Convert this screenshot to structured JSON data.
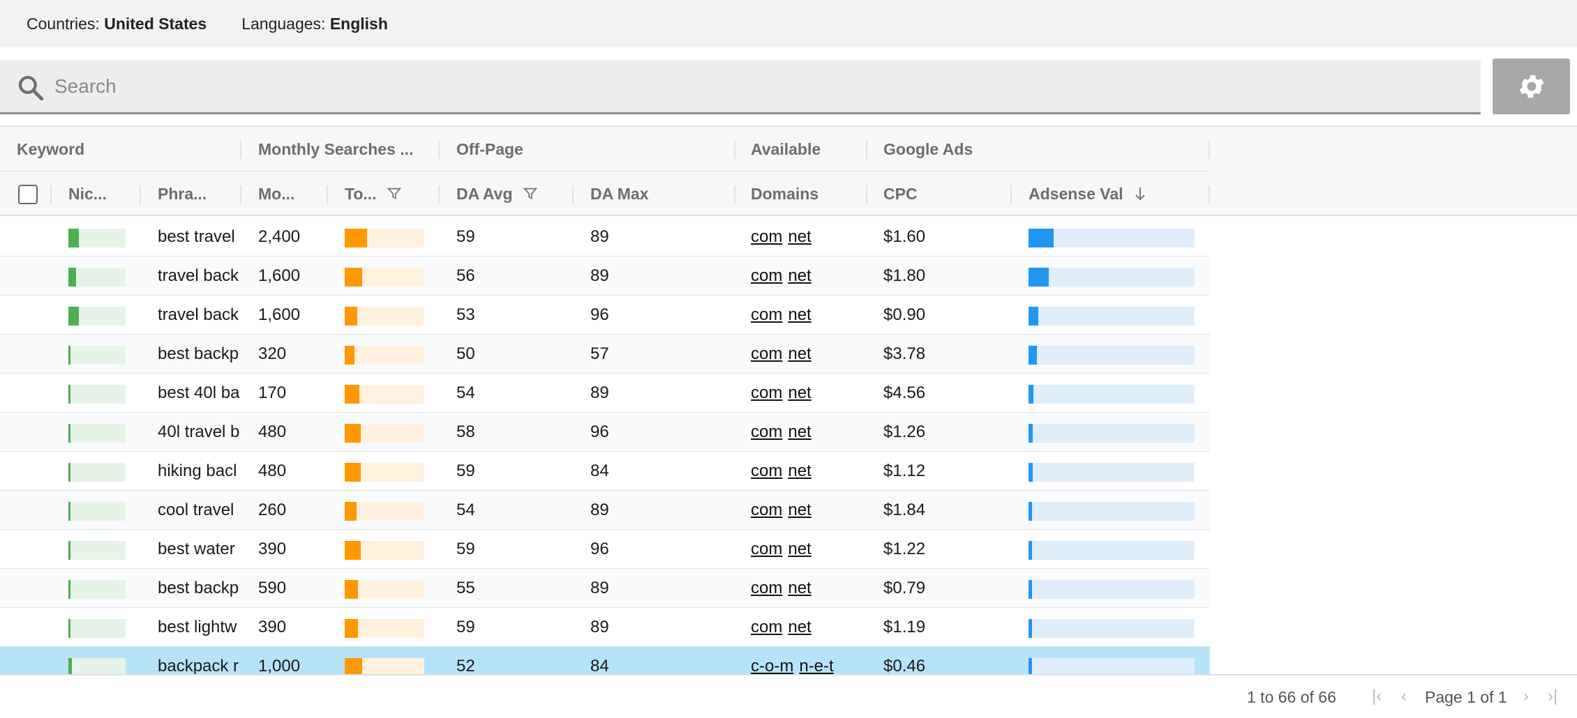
{
  "filters": {
    "countries_label": "Countries:",
    "countries_value": "United States",
    "languages_label": "Languages:",
    "languages_value": "English"
  },
  "search": {
    "placeholder": "Search"
  },
  "header_groups": [
    "Keyword",
    "Monthly Searches ...",
    "Off-Page",
    "Available",
    "Google Ads"
  ],
  "columns": [
    "Nic...",
    "Phra...",
    "Mo...",
    "To...",
    "DA Avg",
    "DA Max",
    "Domains",
    "CPC",
    "Adsense Val"
  ],
  "rows": [
    {
      "niche": 0.18,
      "phrase": "best travel",
      "monthly": "2,400",
      "to": 0.28,
      "da_avg": "59",
      "da_max": "89",
      "domains": [
        "com",
        "net"
      ],
      "cpc": "$1.60",
      "adsense": 0.15
    },
    {
      "niche": 0.14,
      "phrase": "travel back",
      "monthly": "1,600",
      "to": 0.22,
      "da_avg": "56",
      "da_max": "89",
      "domains": [
        "com",
        "net"
      ],
      "cpc": "$1.80",
      "adsense": 0.12
    },
    {
      "niche": 0.18,
      "phrase": "travel back",
      "monthly": "1,600",
      "to": 0.16,
      "da_avg": "53",
      "da_max": "96",
      "domains": [
        "com",
        "net"
      ],
      "cpc": "$0.90",
      "adsense": 0.06
    },
    {
      "niche": 0.04,
      "phrase": "best backp",
      "monthly": "320",
      "to": 0.12,
      "da_avg": "50",
      "da_max": "57",
      "domains": [
        "com",
        "net"
      ],
      "cpc": "$3.78",
      "adsense": 0.05
    },
    {
      "niche": 0.03,
      "phrase": "best 40l ba",
      "monthly": "170",
      "to": 0.18,
      "da_avg": "54",
      "da_max": "89",
      "domains": [
        "com",
        "net"
      ],
      "cpc": "$4.56",
      "adsense": 0.03
    },
    {
      "niche": 0.04,
      "phrase": "40l travel b",
      "monthly": "480",
      "to": 0.2,
      "da_avg": "58",
      "da_max": "96",
      "domains": [
        "com",
        "net"
      ],
      "cpc": "$1.26",
      "adsense": 0.025
    },
    {
      "niche": 0.04,
      "phrase": "hiking bacl",
      "monthly": "480",
      "to": 0.2,
      "da_avg": "59",
      "da_max": "84",
      "domains": [
        "com",
        "net"
      ],
      "cpc": "$1.12",
      "adsense": 0.025
    },
    {
      "niche": 0.02,
      "phrase": "cool travel",
      "monthly": "260",
      "to": 0.15,
      "da_avg": "54",
      "da_max": "89",
      "domains": [
        "com",
        "net"
      ],
      "cpc": "$1.84",
      "adsense": 0.02
    },
    {
      "niche": 0.02,
      "phrase": "best water",
      "monthly": "390",
      "to": 0.2,
      "da_avg": "59",
      "da_max": "96",
      "domains": [
        "com",
        "net"
      ],
      "cpc": "$1.22",
      "adsense": 0.02
    },
    {
      "niche": 0.03,
      "phrase": "best backp",
      "monthly": "590",
      "to": 0.17,
      "da_avg": "55",
      "da_max": "89",
      "domains": [
        "com",
        "net"
      ],
      "cpc": "$0.79",
      "adsense": 0.02
    },
    {
      "niche": 0.03,
      "phrase": "best lightw",
      "monthly": "390",
      "to": 0.17,
      "da_avg": "59",
      "da_max": "89",
      "domains": [
        "com",
        "net"
      ],
      "cpc": "$1.19",
      "adsense": 0.02
    },
    {
      "niche": 0.06,
      "phrase": "backpack r",
      "monthly": "1,000",
      "to": 0.22,
      "da_avg": "52",
      "da_max": "84",
      "domains": [
        "c-o-m",
        "n-e-t"
      ],
      "cpc": "$0.46",
      "adsense": 0.02,
      "selected": true
    }
  ],
  "footer": {
    "summary": "1 to 66 of 66",
    "page_info": "Page 1 of 1"
  },
  "colors": {
    "niche_fill": "#4caf50",
    "niche_track": "#e6f4e8",
    "to_fill": "#ff9800",
    "to_track": "#fff1de",
    "adsense_fill": "#2196f3",
    "adsense_track": "#e0eefb",
    "selected_row": "#b7e3f9"
  },
  "icons": [
    "search-icon",
    "gear-icon",
    "filter-icon",
    "arrow-down-icon",
    "first-page-icon",
    "prev-page-icon",
    "next-page-icon",
    "last-page-icon"
  ]
}
